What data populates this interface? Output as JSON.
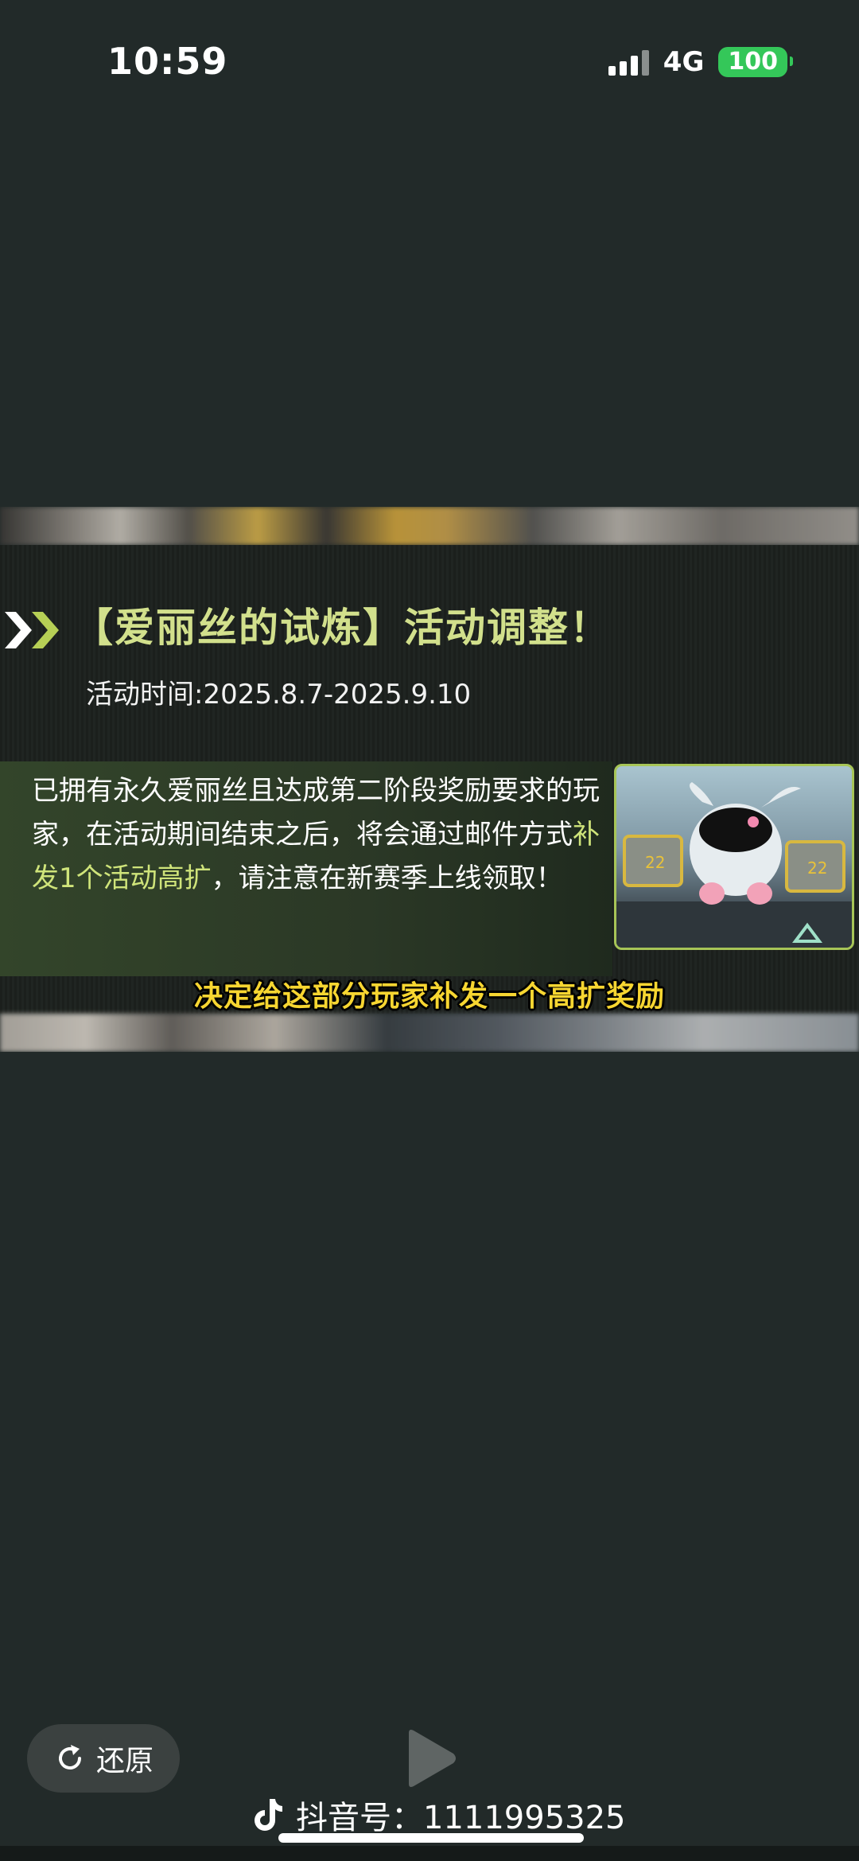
{
  "status_bar": {
    "time": "10:59",
    "network": "4G",
    "battery": "100"
  },
  "video": {
    "title": "【爱丽丝的试炼】活动调整！",
    "time_label": "活动时间:2025.8.7-2025.9.10",
    "desc_part1": "已拥有永久爱丽丝且达成第二阶段奖励要求的玩家，在活动期间结束之后，将会通过邮件方式",
    "desc_highlight": "补发1个活动高扩",
    "desc_part2": "，请注意在新赛季上线领取！",
    "subtitle": "决定给这部分玩家补发一个高扩奖励",
    "thumb_badge": "22"
  },
  "controls": {
    "restore_label": "还原",
    "douyin_id": "抖音号：1111995325"
  },
  "colors": {
    "title": "#d2e08c",
    "highlight": "#cfe47a",
    "subtitle": "#f7d631",
    "battery": "#34c759"
  }
}
